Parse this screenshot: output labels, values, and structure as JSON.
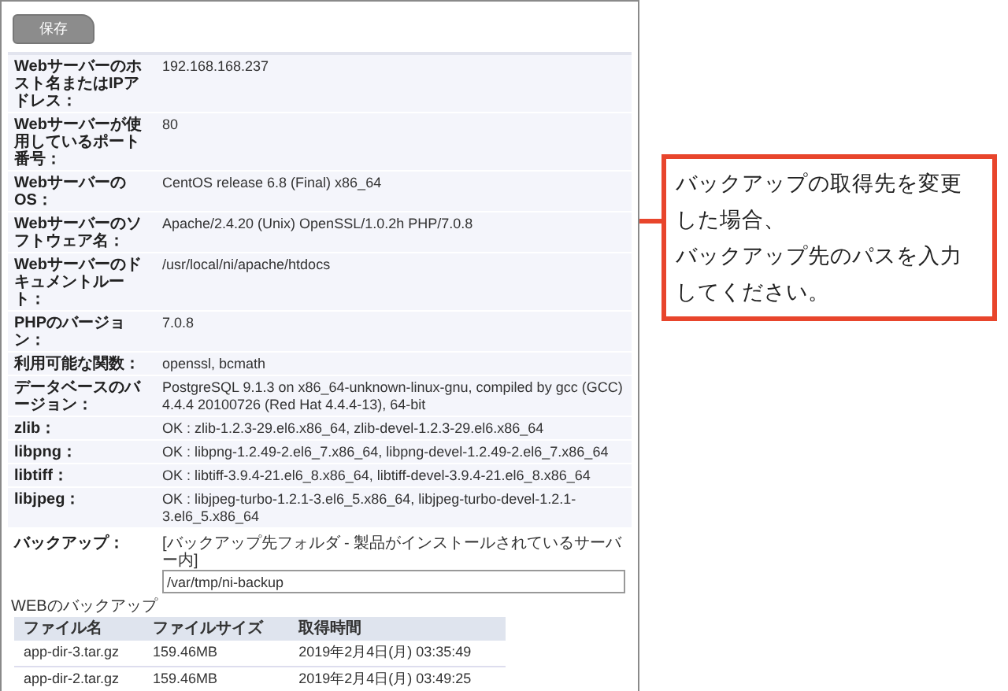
{
  "save_button": "保存",
  "info_rows": [
    {
      "label": "Webサーバーのホスト名またはIPアドレス：",
      "value": "192.168.168.237"
    },
    {
      "label": "Webサーバーが使用しているポート番号：",
      "value": "80"
    },
    {
      "label": "WebサーバーのOS：",
      "value": "CentOS release 6.8 (Final) x86_64"
    },
    {
      "label": "Webサーバーのソフトウェア名：",
      "value": "Apache/2.4.20 (Unix) OpenSSL/1.0.2h PHP/7.0.8"
    },
    {
      "label": "Webサーバーのドキュメントルート：",
      "value": "/usr/local/ni/apache/htdocs"
    },
    {
      "label": "PHPのバージョン：",
      "value": "7.0.8"
    },
    {
      "label": "利用可能な関数：",
      "value": "openssl, bcmath"
    },
    {
      "label": "データベースのバージョン：",
      "value": "PostgreSQL 9.1.3 on x86_64-unknown-linux-gnu, compiled by gcc (GCC) 4.4.4 20100726 (Red Hat 4.4.4-13), 64-bit"
    },
    {
      "label": "zlib：",
      "value": "OK : zlib-1.2.3-29.el6.x86_64, zlib-devel-1.2.3-29.el6.x86_64"
    },
    {
      "label": "libpng：",
      "value": "OK : libpng-1.2.49-2.el6_7.x86_64, libpng-devel-1.2.49-2.el6_7.x86_64"
    },
    {
      "label": "libtiff：",
      "value": "OK : libtiff-3.9.4-21.el6_8.x86_64, libtiff-devel-3.9.4-21.el6_8.x86_64"
    },
    {
      "label": "libjpeg：",
      "value": "OK : libjpeg-turbo-1.2.1-3.el6_5.x86_64, libjpeg-turbo-devel-1.2.1-3.el6_5.x86_64"
    }
  ],
  "backup": {
    "label": "バックアップ：",
    "hint": "[バックアップ先フォルダ - 製品がインストールされているサーバー内]",
    "path": "/var/tmp/ni-backup"
  },
  "web_backup": {
    "title": "WEBのバックアップ",
    "columns": [
      "ファイル名",
      "ファイルサイズ",
      "取得時間"
    ],
    "rows": [
      [
        "app-dir-3.tar.gz",
        "159.46MB",
        "2019年2月4日(月) 03:35:49"
      ],
      [
        "app-dir-2.tar.gz",
        "159.46MB",
        "2019年2月4日(月) 03:49:25"
      ]
    ]
  },
  "callout": {
    "lines": [
      "バックアップの取得先を変更した場合、",
      "バックアップ先のパスを入力してください。"
    ]
  }
}
